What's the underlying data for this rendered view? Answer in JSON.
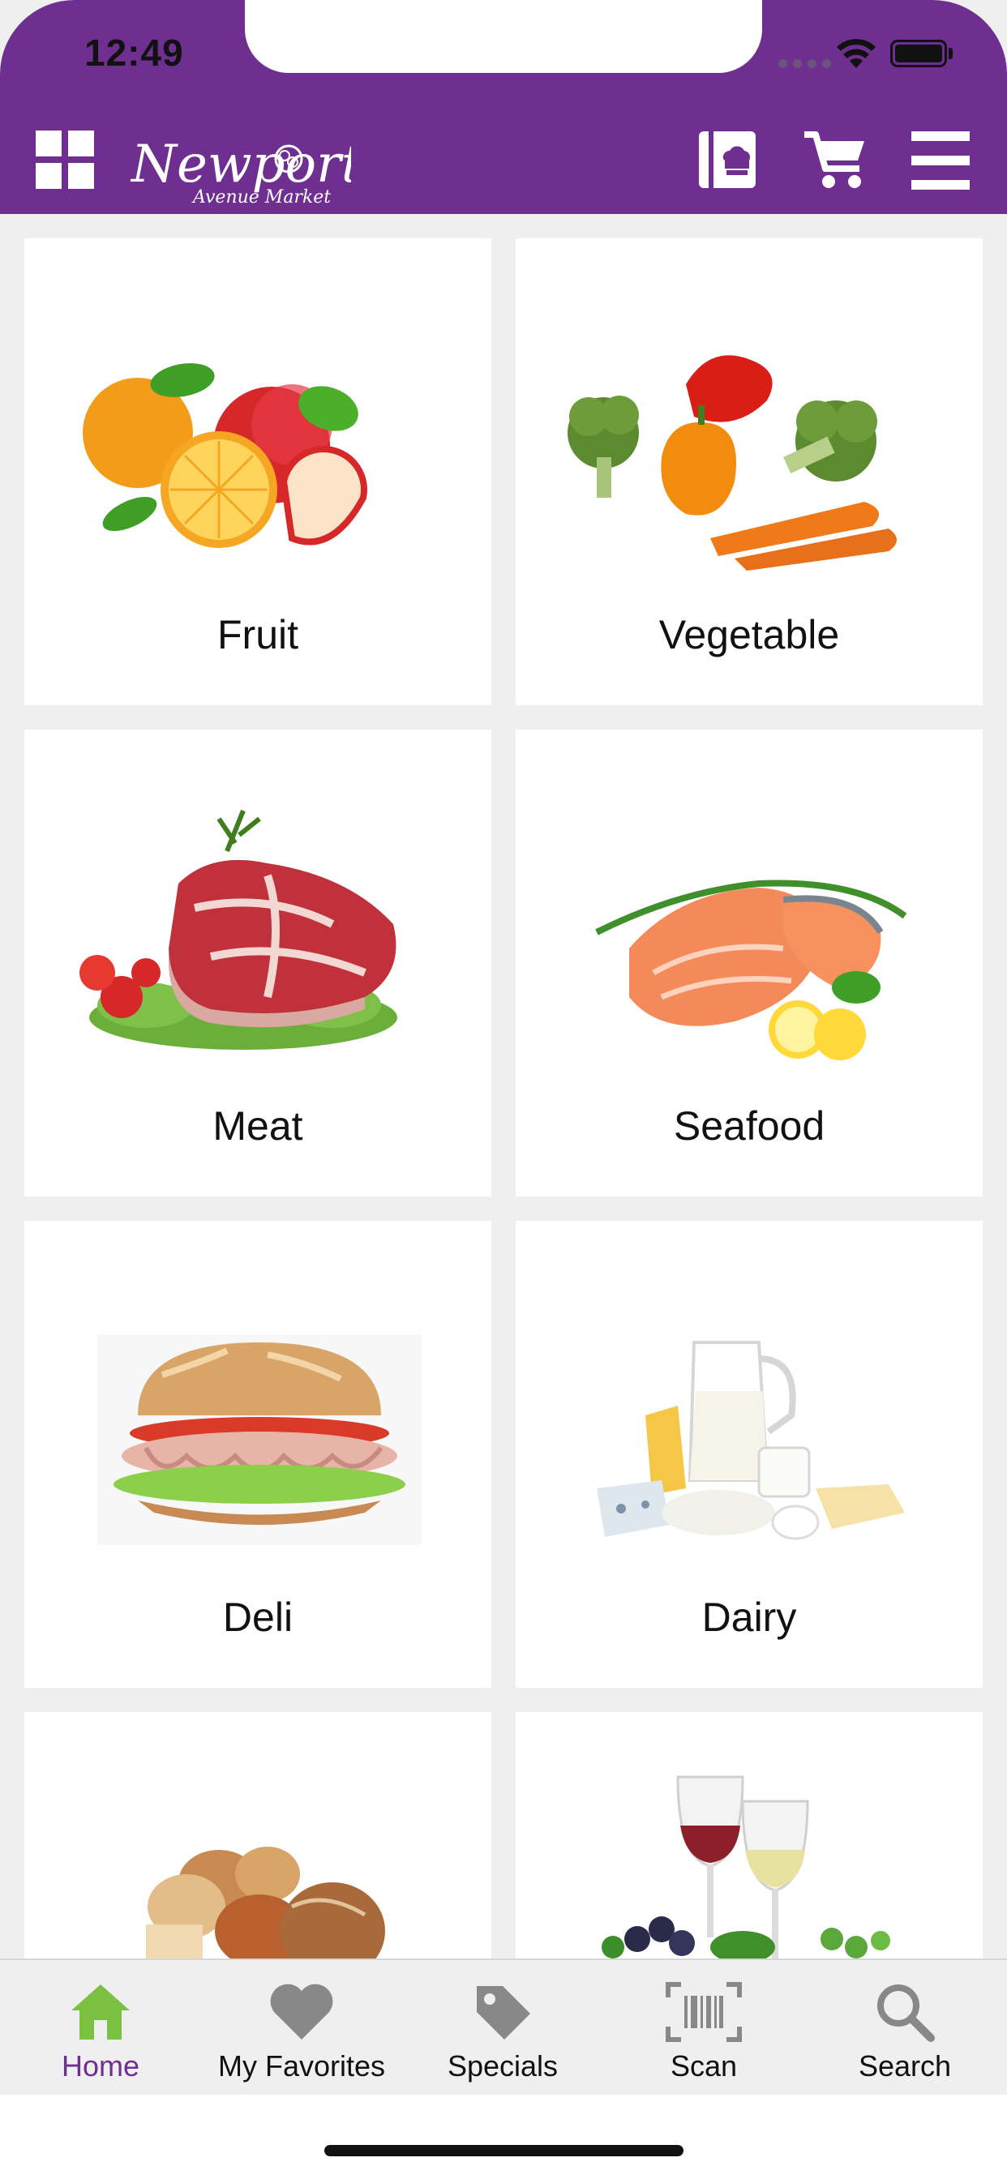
{
  "status_bar": {
    "time": "12:49"
  },
  "header": {
    "logo_text": "Newport",
    "logo_subtext": "Avenue Market",
    "icons": [
      "grid-icon",
      "recipe-book-icon",
      "cart-icon",
      "menu-icon"
    ],
    "brand_color": "#6e2f91"
  },
  "categories": [
    {
      "label": "Fruit"
    },
    {
      "label": "Vegetable"
    },
    {
      "label": "Meat"
    },
    {
      "label": "Seafood"
    },
    {
      "label": "Deli"
    },
    {
      "label": "Dairy"
    },
    {
      "label": ""
    },
    {
      "label": ""
    }
  ],
  "tabbar": {
    "tabs": [
      {
        "label": "Home",
        "icon": "home-icon",
        "active": true
      },
      {
        "label": "My Favorites",
        "icon": "heart-icon",
        "active": false
      },
      {
        "label": "Specials",
        "icon": "tag-icon",
        "active": false
      },
      {
        "label": "Scan",
        "icon": "barcode-icon",
        "active": false
      },
      {
        "label": "Search",
        "icon": "search-icon",
        "active": false
      }
    ],
    "active_color": "#6e2f91",
    "active_icon_color": "#7cc242",
    "inactive_icon_color": "#888888"
  }
}
